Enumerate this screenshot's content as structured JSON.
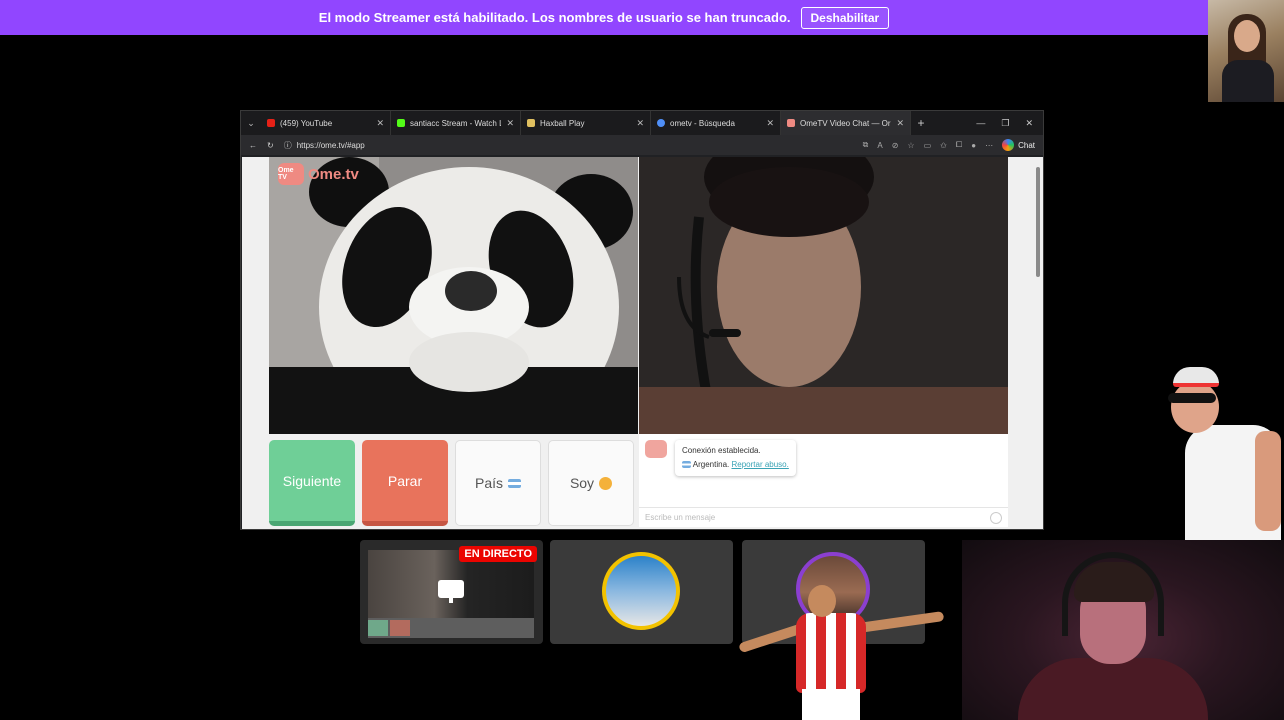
{
  "banner": {
    "message": "El modo Streamer está habilitado. Los nombres de usuario se han truncado.",
    "button_label": "Deshabilitar",
    "color": "#9146ff"
  },
  "browser": {
    "tabs": [
      {
        "title": "(459) YouTube",
        "icon": "youtube-icon",
        "color": "#e62117"
      },
      {
        "title": "santiacc Stream - Watch Live o",
        "icon": "kick-icon",
        "color": "#53fc18"
      },
      {
        "title": "Haxball Play",
        "icon": "haxball-icon",
        "color": "#e0c060"
      },
      {
        "title": "ometv - Búsqueda",
        "icon": "search-icon",
        "color": "#4f8ff7"
      },
      {
        "title": "OmeTV Video Chat — Or",
        "icon": "ometv-icon",
        "color": "#ef8a82"
      }
    ],
    "url": "https://ome.tv/#app",
    "chat_label": "Chat"
  },
  "ometv": {
    "logo_text": "Ome.tv",
    "logo_mark": "Ome TV",
    "buttons": {
      "next": "Siguiente",
      "stop": "Parar",
      "country": "País",
      "me": "Soy"
    },
    "chat": {
      "status": "Conexión establecida.",
      "country": "Argentina.",
      "report_link": "Reportar abuso.",
      "input_placeholder": "Escribe un mensaje"
    }
  },
  "overlay": {
    "live_badge": "EN DIRECTO"
  }
}
